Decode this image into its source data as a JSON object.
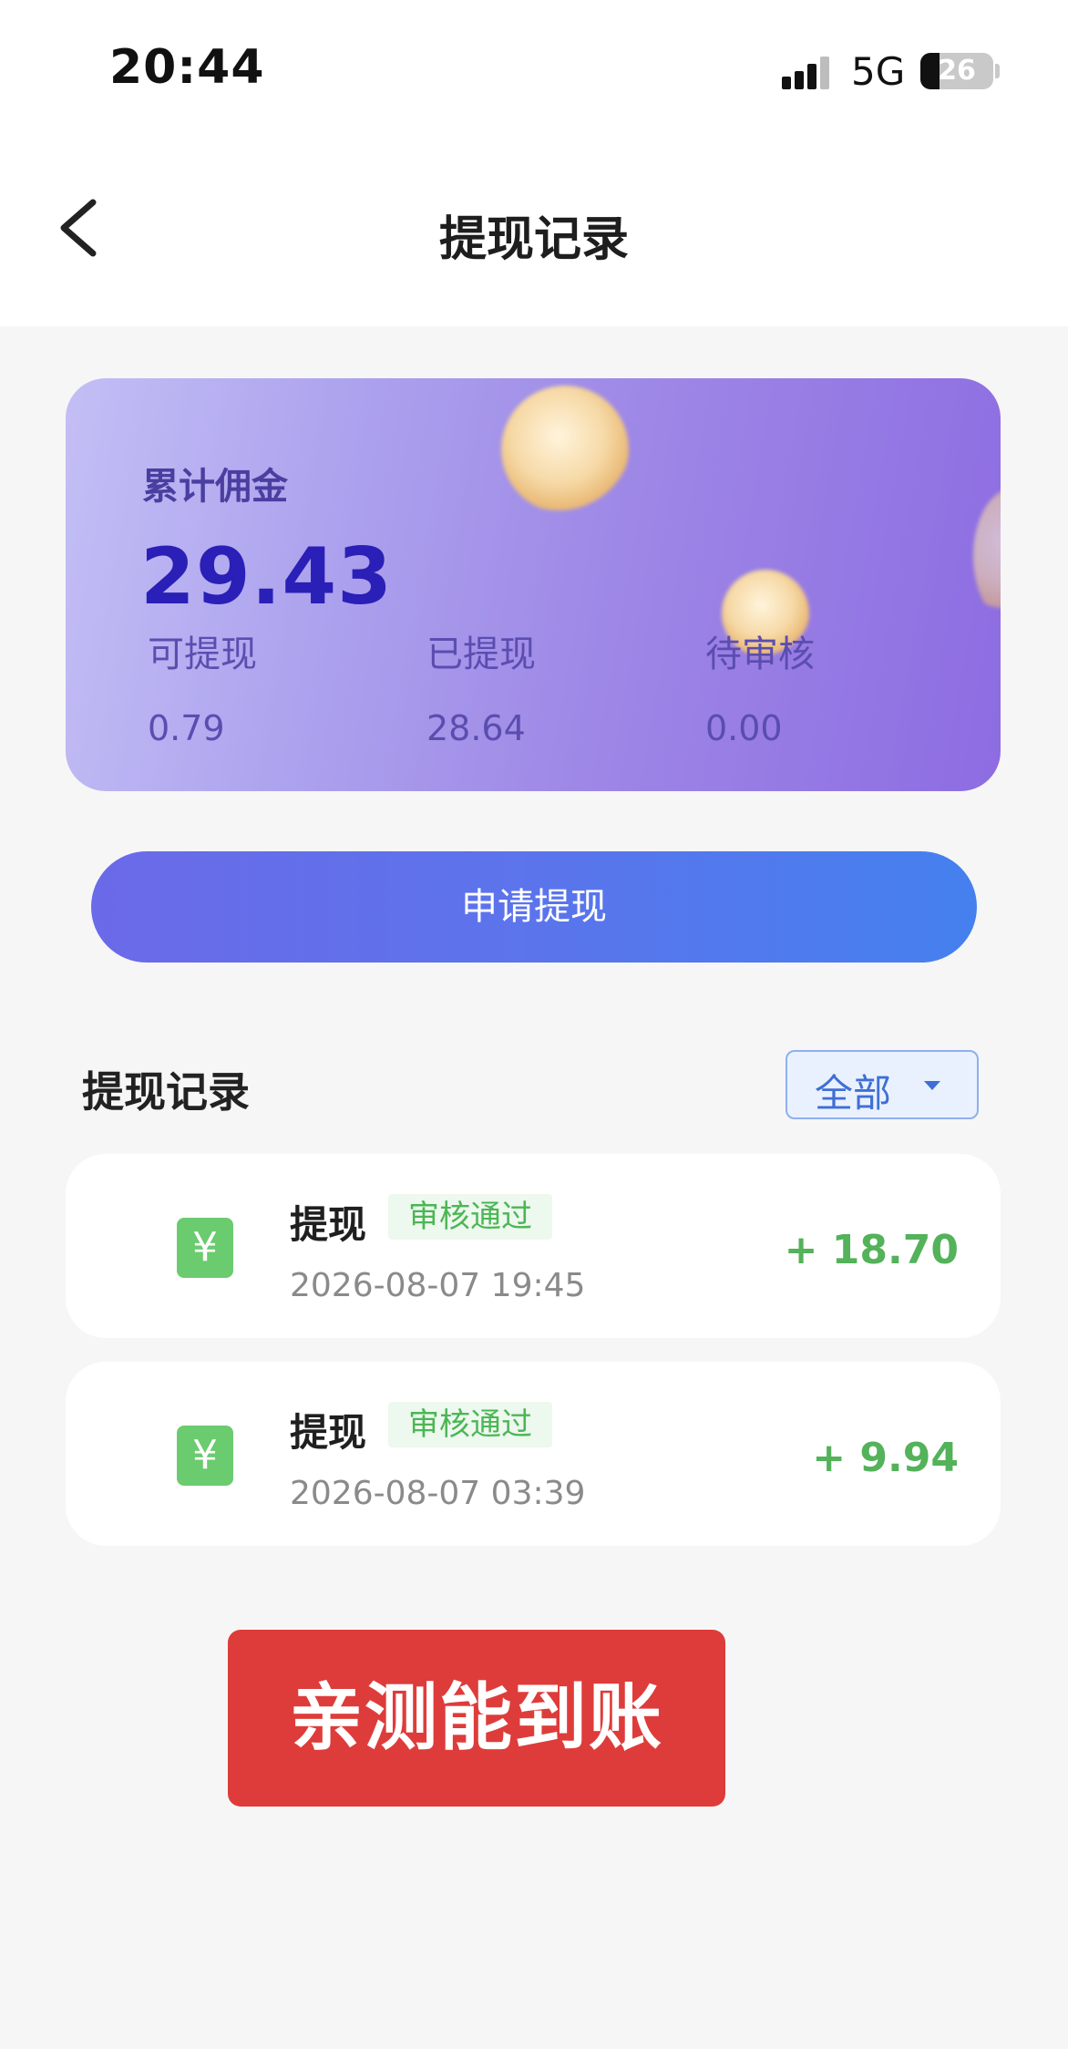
{
  "status_bar": {
    "time": "20:44",
    "network": "5G",
    "battery": "26",
    "battery_level": 0.26
  },
  "nav": {
    "title": "提现记录",
    "back_icon": "chevron-left-icon"
  },
  "summary": {
    "total_label": "累计佣金",
    "total_value": "29.43",
    "stats": [
      {
        "label": "可提现",
        "value": "0.79"
      },
      {
        "label": "已提现",
        "value": "28.64"
      },
      {
        "label": "待审核",
        "value": "0.00"
      }
    ]
  },
  "apply_button": {
    "label": "申请提现"
  },
  "records": {
    "title": "提现记录",
    "filter": {
      "label": "全部",
      "icon": "caret-down-icon"
    },
    "items": [
      {
        "icon": "yen-icon",
        "icon_glyph": "¥",
        "type": "提现",
        "status": "审核通过",
        "time": "2026-08-07 19:45",
        "amount": "+ 18.70"
      },
      {
        "icon": "yen-icon",
        "icon_glyph": "¥",
        "type": "提现",
        "status": "审核通过",
        "time": "2026-08-07 03:39",
        "amount": "+ 9.94"
      }
    ]
  },
  "banner": {
    "text": "亲测能到账"
  },
  "colors": {
    "accent_blue": "#4580ee",
    "accent_purple": "#6b6ae8",
    "success_green": "#53b25a",
    "banner_red": "#de3c3a",
    "total_value": "#2a1fb6"
  }
}
